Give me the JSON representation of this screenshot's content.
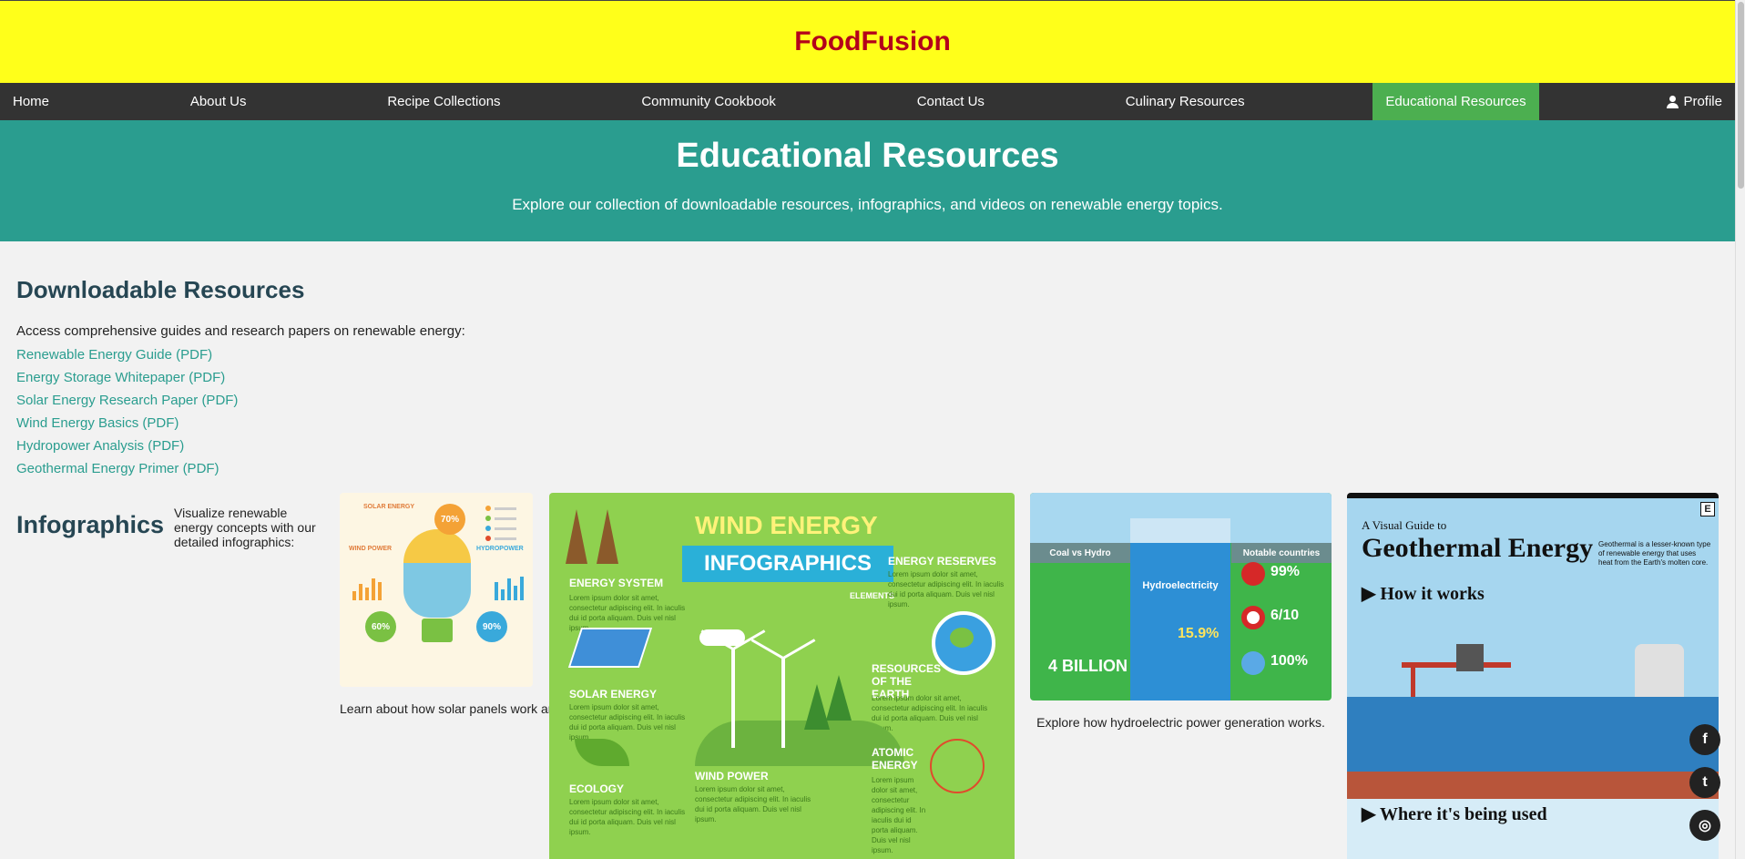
{
  "header": {
    "brand": "FoodFusion"
  },
  "nav": {
    "items": [
      {
        "label": "Home"
      },
      {
        "label": "About Us"
      },
      {
        "label": "Recipe Collections"
      },
      {
        "label": "Community Cookbook"
      },
      {
        "label": "Contact Us"
      },
      {
        "label": "Culinary Resources"
      },
      {
        "label": "Educational Resources",
        "active": true
      }
    ],
    "profile": "Profile"
  },
  "hero": {
    "title": "Educational Resources",
    "subtitle": "Explore our collection of downloadable resources, infographics, and videos on renewable energy topics."
  },
  "downloads": {
    "title": "Downloadable Resources",
    "intro": "Access comprehensive guides and research papers on renewable energy:",
    "links": [
      "Renewable Energy Guide (PDF)",
      "Energy Storage Whitepaper (PDF)",
      "Solar Energy Research Paper (PDF)",
      "Wind Energy Basics (PDF)",
      "Hydropower Analysis (PDF)",
      "Geothermal Energy Primer (PDF)"
    ]
  },
  "infographics": {
    "title": "Infographics",
    "description": "Visualize renewable energy concepts with our detailed infographics:",
    "solar": {
      "caption": "Learn about how solar panels work and their efficiency.",
      "label_a": "SOLAR ENERGY",
      "label_b": "WIND POWER",
      "label_c": "HYDROPOWER",
      "pct_a": "70%",
      "pct_b": "60%",
      "pct_c": "90%"
    },
    "wind": {
      "title": "WIND ENERGY",
      "banner": "INFOGRAPHICS",
      "elements": "ELEMENTS",
      "labels": [
        "ENERGY SYSTEM",
        "ENERGY RESERVES",
        "SOLAR ENERGY",
        "RESOURCES OF THE EARTH",
        "ECOLOGY",
        "WIND POWER",
        "ATOMIC ENERGY"
      ],
      "lorem": "Lorem ipsum dolor sit amet, consectetur adipiscing elit. In iaculis dui id porta aliquam. Duis vel nisl ipsum."
    },
    "hydro": {
      "caption": "Explore how hydroelectric power generation works.",
      "col_left": "Coal vs Hydro",
      "col_mid": "Hydroelectricity",
      "col_right": "Notable countries",
      "big_left": "4 BILLION",
      "big_mid": "15.9%",
      "stat_1": "99%",
      "stat_2": "6/10",
      "stat_3": "100%"
    },
    "geo": {
      "small": "A Visual Guide to",
      "title": "Geothermal Energy",
      "how": "How it works",
      "where": "Where it's being used",
      "blurb": "Geothermal is a lesser-known type of renewable energy that uses heat from the Earth's molten core.",
      "e": "E"
    }
  },
  "social": {
    "facebook": "f",
    "twitter": "t",
    "instagram": "◎"
  },
  "colors": {
    "header_bg": "#ffff1a",
    "brand": "#b3001b",
    "nav_bg": "#333333",
    "nav_active": "#4caf50",
    "hero_bg": "#2a9d8f",
    "link": "#2a9d8f",
    "heading": "#264653"
  }
}
